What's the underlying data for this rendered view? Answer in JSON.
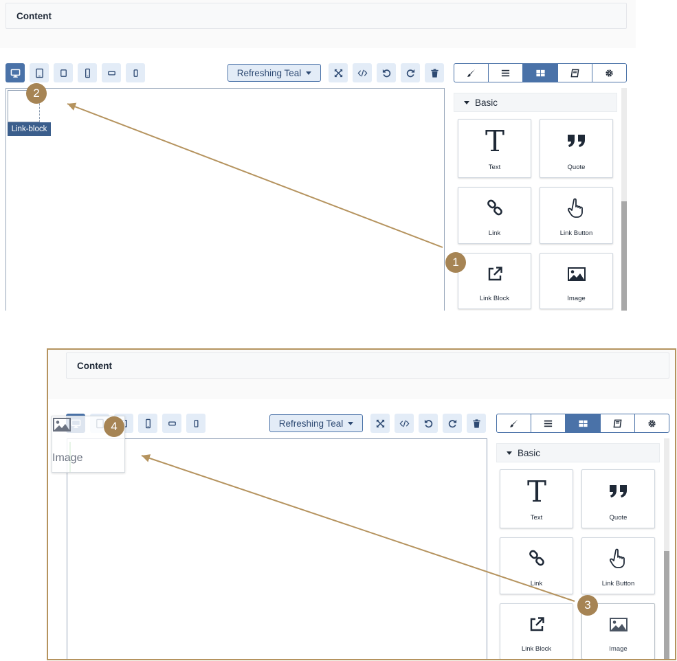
{
  "panels": [
    {
      "content_title": "Content",
      "theme_label": "Refreshing Teal",
      "category_label": "Basic",
      "blocks": [
        "Text",
        "Quote",
        "Link",
        "Link Button",
        "Link Block",
        "Image"
      ],
      "dropped_tag": "Link-block",
      "markers": [
        "1",
        "2"
      ]
    },
    {
      "content_title": "Content",
      "theme_label": "Refreshing Teal",
      "category_label": "Basic",
      "blocks": [
        "Text",
        "Quote",
        "Link",
        "Link Button",
        "Link Block",
        "Image"
      ],
      "drag_label": "Image",
      "markers": [
        "3",
        "4"
      ]
    }
  ],
  "colors": {
    "accent": "#4a72a8",
    "accent_light": "#e3ecf7",
    "annotation": "#a68454",
    "arrow": "#b5935e"
  },
  "icons": {
    "device_buttons": [
      "desktop-icon",
      "tablet-icon",
      "tablet-small-icon",
      "mobile-icon",
      "mobile-landscape-icon",
      "mobile-portrait-icon"
    ],
    "tool_buttons": [
      "fullscreen-icon",
      "code-icon",
      "undo-icon",
      "redo-icon",
      "trash-icon"
    ],
    "tabs": [
      "brush-icon",
      "layers-icon",
      "blocks-icon",
      "book-icon",
      "gear-icon"
    ]
  }
}
